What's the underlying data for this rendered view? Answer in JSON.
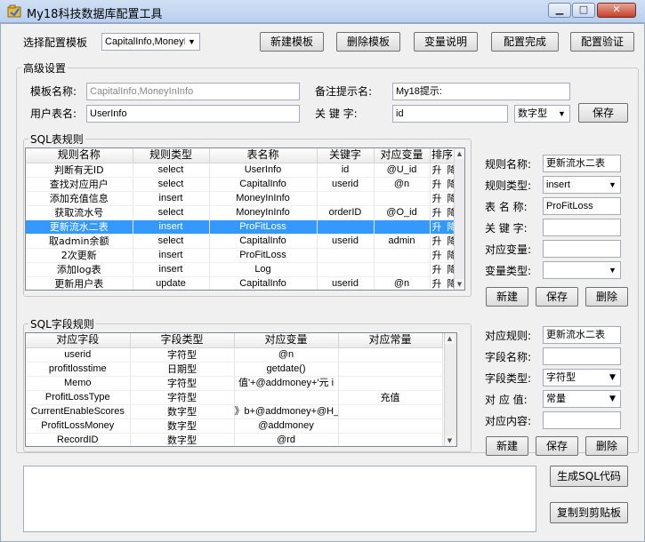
{
  "window": {
    "title": "My18科技数据库配置工具",
    "minimize_glyph": "▁",
    "maximize_glyph": "□",
    "close_glyph": "✕"
  },
  "toolbar": {
    "template_select_label": "选择配置模板",
    "template_select_value": "CapitalInfo,MoneyIn",
    "new_template": "新建模板",
    "delete_template": "删除模板",
    "variable_help": "变量说明",
    "config_done": "配置完成",
    "config_verify": "配置验证"
  },
  "advanced": {
    "legend": "高级设置",
    "template_name_label": "模板名称:",
    "template_name_value": "CapitalInfo,MoneyInInfo",
    "remark_label": "备注提示名:",
    "remark_value": "My18提示:",
    "user_table_label": "用户表名:",
    "user_table_value": "UserInfo",
    "keyword_label": "关 键 字:",
    "keyword_value": "id",
    "keyword_type": "数字型",
    "save": "保存"
  },
  "sql_table": {
    "legend": "SQL表规则",
    "columns": [
      "规则名称",
      "规则类型",
      "表名称",
      "关键字",
      "对应变量",
      "排序"
    ],
    "rows": [
      {
        "name": "判断有无ID",
        "type": "select",
        "table": "UserInfo",
        "key": "id",
        "var": "@U_id",
        "up": "升",
        "down": "降"
      },
      {
        "name": "查找对应用户",
        "type": "select",
        "table": "CapitalInfo",
        "key": "userid",
        "var": "@n",
        "up": "升",
        "down": "降"
      },
      {
        "name": "添加充值信息",
        "type": "insert",
        "table": "MoneyInInfo",
        "key": "",
        "var": "",
        "up": "升",
        "down": "降"
      },
      {
        "name": "获取流水号",
        "type": "select",
        "table": "MoneyInInfo",
        "key": "orderID",
        "var": "@O_id",
        "up": "升",
        "down": "降"
      },
      {
        "name": "更新流水二表",
        "type": "insert",
        "table": "ProFitLoss",
        "key": "",
        "var": "",
        "up": "升",
        "down": "降",
        "selected": true
      },
      {
        "name": "取admin余额",
        "type": "select",
        "table": "CapitalInfo",
        "key": "userid",
        "var": "admin",
        "up": "升",
        "down": "降"
      },
      {
        "name": "2次更新",
        "type": "insert",
        "table": "ProFitLoss",
        "key": "",
        "var": "",
        "up": "升",
        "down": "降"
      },
      {
        "name": "添加log表",
        "type": "insert",
        "table": "Log",
        "key": "",
        "var": "",
        "up": "升",
        "down": "降"
      },
      {
        "name": "更新用户表",
        "type": "update",
        "table": "CapitalInfo",
        "key": "userid",
        "var": "@n",
        "up": "升",
        "down": "降"
      }
    ]
  },
  "rule_form": {
    "name_label": "规则名称:",
    "name_value": "更新流水二表",
    "type_label": "规则类型:",
    "type_value": "insert",
    "table_label": "表 名 称:",
    "table_value": "ProFitLoss",
    "key_label": "关 键 字:",
    "key_value": "",
    "var_label": "对应变量:",
    "var_value": "",
    "vartype_label": "变量类型:",
    "vartype_value": "",
    "new": "新建",
    "save": "保存",
    "delete": "删除"
  },
  "sql_field": {
    "legend": "SQL字段规则",
    "columns": [
      "对应字段",
      "字段类型",
      "对应变量",
      "对应常量"
    ],
    "rows": [
      {
        "field": "userid",
        "type": "字符型",
        "var": "@n",
        "const": ""
      },
      {
        "field": "profitlosstime",
        "type": "日期型",
        "var": "getdate()",
        "const": ""
      },
      {
        "field": "Memo",
        "type": "字符型",
        "var": "值'+@addmoney+'元  i",
        "const": ""
      },
      {
        "field": "ProfitLossType",
        "type": "字符型",
        "var": "",
        "const": "充值"
      },
      {
        "field": "CurrentEnableScores",
        "type": "数字型",
        "var": "》b+@addmoney+@H_fe",
        "const": ""
      },
      {
        "field": "ProfitLossMoney",
        "type": "数字型",
        "var": "@addmoney",
        "const": ""
      },
      {
        "field": "RecordID",
        "type": "数字型",
        "var": "@rd",
        "const": ""
      }
    ]
  },
  "field_form": {
    "rule_label": "对应规则:",
    "rule_value": "更新流水二表",
    "field_label": "字段名称:",
    "field_value": "",
    "fieldtype_label": "字段类型:",
    "fieldtype_value": "字符型",
    "value_label": "对 应 值:",
    "value_value": "常量",
    "content_label": "对应内容:",
    "content_value": "",
    "new": "新建",
    "save": "保存",
    "delete": "删除"
  },
  "bottom": {
    "gen_sql": "生成SQL代码",
    "copy": "复制到剪贴板"
  },
  "icons": {
    "scroll_up": "▲",
    "scroll_down": "▼",
    "dropdown": "▼"
  }
}
